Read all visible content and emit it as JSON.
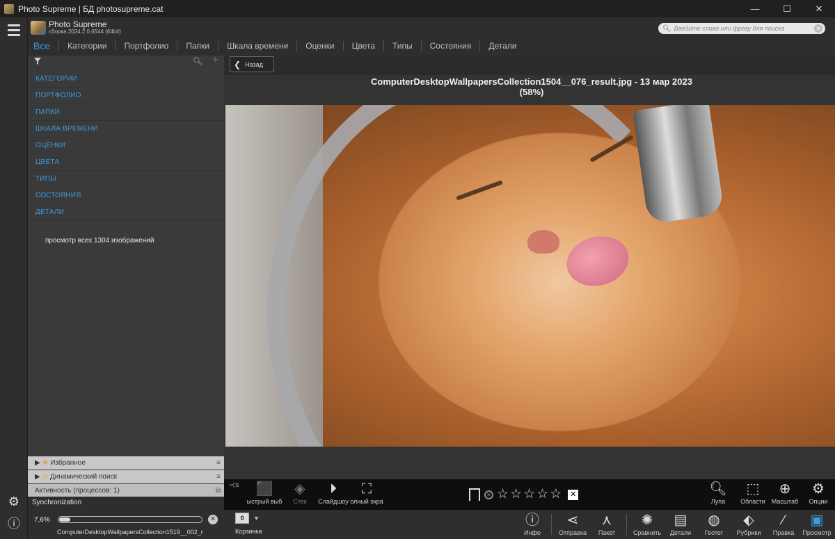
{
  "window": {
    "title": "Photo Supreme | БД photosupreme.cat",
    "controls": {
      "minimize": "—",
      "maximize": "☐",
      "close": "✕"
    }
  },
  "app": {
    "name": "Photo Supreme",
    "build": "сборка 2024.2.0.6544 (64bit)"
  },
  "search": {
    "placeholder": "Введите слово или фразу для поиска"
  },
  "tabs": [
    "Все",
    "Категории",
    "Портфолио",
    "Папки",
    "Шкала времени",
    "Оценки",
    "Цвета",
    "Типы",
    "Состояния",
    "Детали"
  ],
  "sidebar": {
    "items": [
      "КАТЕГОРИИ",
      "ПОРТФОЛИО",
      "ПАПКИ",
      "ШКАЛА ВРЕМЕНИ",
      "ОЦЕНКИ",
      "ЦВЕТА",
      "ТИПЫ",
      "СОСТОЯНИЯ",
      "ДЕТАЛИ"
    ],
    "view_all": "просмотр всех 1304 изображений",
    "favorites": "Избранное",
    "dynamic_search": "Динамический поиск",
    "activity": "Активность (процессов: 1)"
  },
  "sync": {
    "label": "Synchronization",
    "percent": "7,6%",
    "progress": 0.076,
    "file": "ComputerDesktopWallpapersCollection1519__002_r"
  },
  "viewer": {
    "back_label": "Назад",
    "title_line1": "ComputerDesktopWallpapersCollection1504__076_result.jpg  -  13 мар 2023",
    "title_line2": "(58%)"
  },
  "toolbar_top": {
    "left": [
      "ыстрый выб",
      "Стек",
      "Слайдшоу",
      "олный экра"
    ],
    "right": [
      "Лупа",
      "Области",
      "Масштаб",
      "Опции"
    ],
    "rating_stars": 5
  },
  "toolbar_bottom": {
    "basket_count": "0",
    "basket_label": "Корзинка",
    "items": [
      "Инфо",
      "Отправка",
      "Пакет",
      "Сравнить",
      "Детали",
      "Геотег",
      "Рубрики",
      "Правка",
      "Просмотр"
    ]
  },
  "colors": {
    "accent": "#3a9bdc"
  }
}
